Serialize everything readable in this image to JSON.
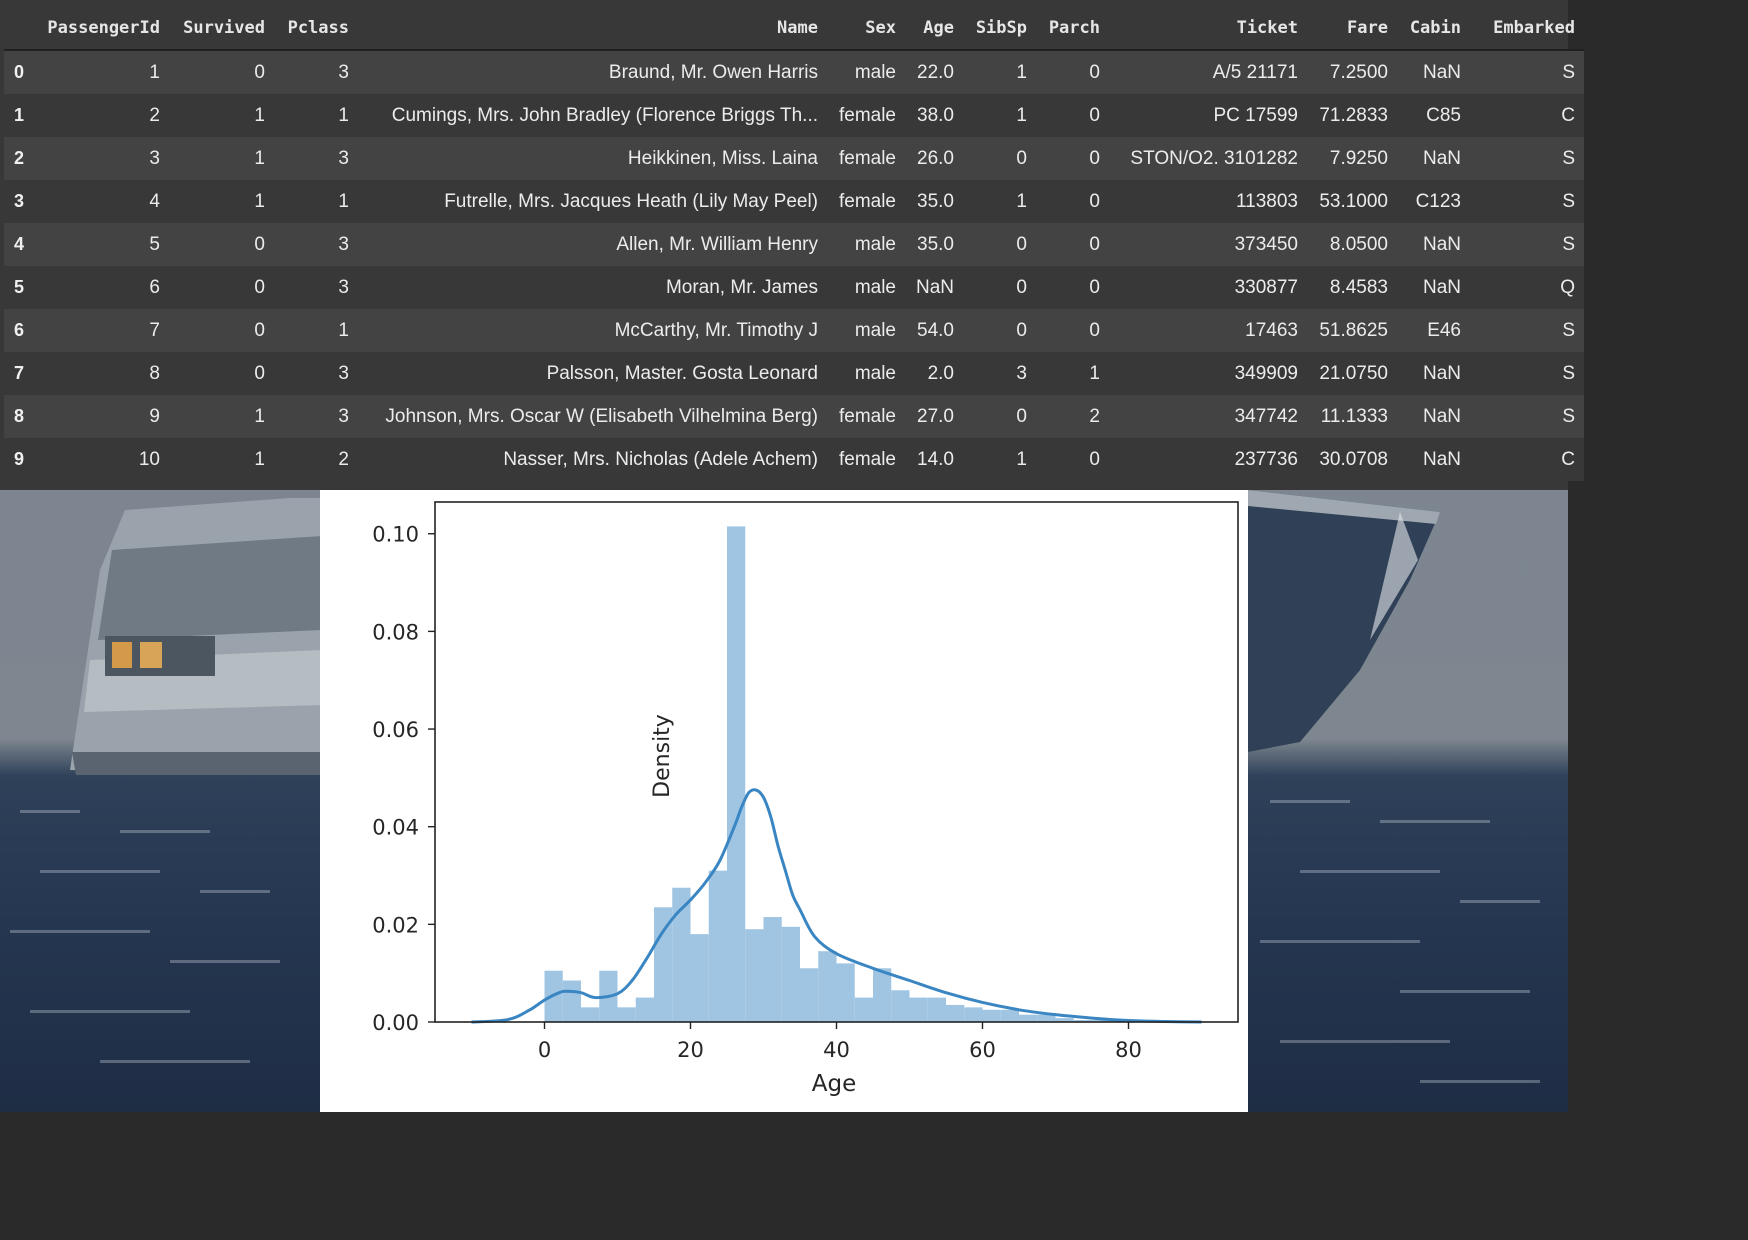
{
  "dataframe": {
    "columns": [
      "",
      "PassengerId",
      "Survived",
      "Pclass",
      "Name",
      "Sex",
      "Age",
      "SibSp",
      "Parch",
      "Ticket",
      "Fare",
      "Cabin",
      "Embarked"
    ],
    "rows": [
      [
        "0",
        "1",
        "0",
        "3",
        "Braund, Mr. Owen Harris",
        "male",
        "22.0",
        "1",
        "0",
        "A/5 21171",
        "7.2500",
        "NaN",
        "S"
      ],
      [
        "1",
        "2",
        "1",
        "1",
        "Cumings, Mrs. John Bradley (Florence Briggs Th...",
        "female",
        "38.0",
        "1",
        "0",
        "PC 17599",
        "71.2833",
        "C85",
        "C"
      ],
      [
        "2",
        "3",
        "1",
        "3",
        "Heikkinen, Miss. Laina",
        "female",
        "26.0",
        "0",
        "0",
        "STON/O2. 3101282",
        "7.9250",
        "NaN",
        "S"
      ],
      [
        "3",
        "4",
        "1",
        "1",
        "Futrelle, Mrs. Jacques Heath (Lily May Peel)",
        "female",
        "35.0",
        "1",
        "0",
        "113803",
        "53.1000",
        "C123",
        "S"
      ],
      [
        "4",
        "5",
        "0",
        "3",
        "Allen, Mr. William Henry",
        "male",
        "35.0",
        "0",
        "0",
        "373450",
        "8.0500",
        "NaN",
        "S"
      ],
      [
        "5",
        "6",
        "0",
        "3",
        "Moran, Mr. James",
        "male",
        "NaN",
        "0",
        "0",
        "330877",
        "8.4583",
        "NaN",
        "Q"
      ],
      [
        "6",
        "7",
        "0",
        "1",
        "McCarthy, Mr. Timothy J",
        "male",
        "54.0",
        "0",
        "0",
        "17463",
        "51.8625",
        "E46",
        "S"
      ],
      [
        "7",
        "8",
        "0",
        "3",
        "Palsson, Master. Gosta Leonard",
        "male",
        "2.0",
        "3",
        "1",
        "349909",
        "21.0750",
        "NaN",
        "S"
      ],
      [
        "8",
        "9",
        "1",
        "3",
        "Johnson, Mrs. Oscar W (Elisabeth Vilhelmina Berg)",
        "female",
        "27.0",
        "0",
        "2",
        "347742",
        "11.1333",
        "NaN",
        "S"
      ],
      [
        "9",
        "10",
        "1",
        "2",
        "Nasser, Mrs. Nicholas (Adele Achem)",
        "female",
        "14.0",
        "1",
        "0",
        "237736",
        "30.0708",
        "NaN",
        "C"
      ]
    ]
  },
  "chart_data": {
    "type": "bar",
    "title": "",
    "xlabel": "Age",
    "ylabel": "Density",
    "xlim": [
      -15,
      95
    ],
    "ylim": [
      0,
      0.1065
    ],
    "xticks": [
      0,
      20,
      40,
      60,
      80
    ],
    "yticks": [
      0.0,
      0.02,
      0.04,
      0.06,
      0.08,
      0.1
    ],
    "ytick_labels": [
      "0.00",
      "0.02",
      "0.04",
      "0.06",
      "0.08",
      "0.10"
    ],
    "grid": false,
    "bar_color": "#9fc5e3",
    "line_color": "#3a86c3",
    "histogram": {
      "bin_edges": [
        0,
        2.5,
        5,
        7.5,
        10,
        12.5,
        15,
        17.5,
        20,
        22.5,
        25,
        27.5,
        30,
        32.5,
        35,
        37.5,
        40,
        42.5,
        45,
        47.5,
        50,
        52.5,
        55,
        57.5,
        60,
        62.5,
        65,
        67.5,
        70,
        72.5,
        75,
        77.5,
        80
      ],
      "density": [
        0.0105,
        0.0085,
        0.003,
        0.0105,
        0.003,
        0.005,
        0.0235,
        0.0275,
        0.018,
        0.031,
        0.1015,
        0.019,
        0.0215,
        0.0195,
        0.011,
        0.0145,
        0.012,
        0.005,
        0.011,
        0.0065,
        0.005,
        0.005,
        0.0035,
        0.003,
        0.0025,
        0.0025,
        0.0015,
        0.0015,
        0.0008,
        0.0004,
        0.0004,
        0.0002
      ]
    },
    "kde": {
      "x": [
        -10,
        -5,
        -2,
        0,
        2,
        3,
        5,
        7,
        10,
        12,
        14,
        16,
        18,
        20,
        22,
        24,
        26,
        27,
        28,
        29,
        30,
        31,
        32,
        33,
        34,
        35,
        37,
        40,
        45,
        50,
        55,
        60,
        65,
        70,
        75,
        80,
        85,
        90
      ],
      "y": [
        0.0,
        0.0005,
        0.0025,
        0.0045,
        0.006,
        0.0063,
        0.006,
        0.005,
        0.0058,
        0.0085,
        0.013,
        0.018,
        0.022,
        0.025,
        0.0285,
        0.033,
        0.04,
        0.044,
        0.047,
        0.0475,
        0.046,
        0.042,
        0.036,
        0.031,
        0.026,
        0.023,
        0.0175,
        0.014,
        0.011,
        0.0085,
        0.006,
        0.004,
        0.0025,
        0.0015,
        0.0008,
        0.0003,
        0.0001,
        0.0
      ]
    }
  }
}
